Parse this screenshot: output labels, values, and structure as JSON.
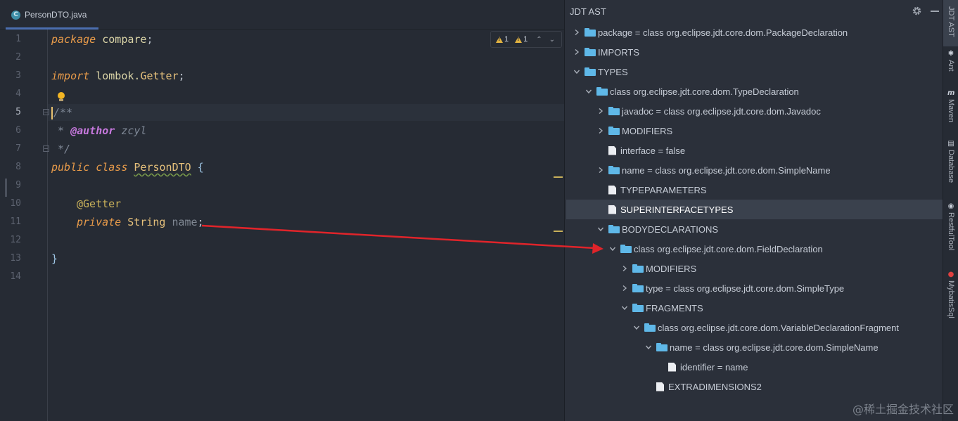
{
  "editor": {
    "tab_label": "PersonDTO.java",
    "tab_icon_letter": "C",
    "line_numbers": [
      "1",
      "2",
      "3",
      "4",
      "5",
      "6",
      "7",
      "8",
      "9",
      "10",
      "11",
      "12",
      "13",
      "14"
    ],
    "code": {
      "l1_kw": "package",
      "l1_name": " compare",
      "l1_semi": ";",
      "l3_kw": "import",
      "l3_pkg": " lombok.",
      "l3_cls": "Getter",
      "l3_semi": ";",
      "l5_open": "/**",
      "l6_star": " * ",
      "l6_tag": "@author",
      "l6_text": " zcyl",
      "l7_close": " */",
      "l8_kw": "public class",
      "l8_space": " ",
      "l8_cls": "PersonDTO",
      "l8_brace": " {",
      "l10_ann": "@Getter",
      "l11_kw": "private",
      "l11_type": " String",
      "l11_field": " name",
      "l11_semi": ";",
      "l13_brace": "}"
    },
    "inspection": {
      "warn1": "1",
      "warn2": "1"
    }
  },
  "panel": {
    "title": "JDT AST",
    "rows": [
      "package = class org.eclipse.jdt.core.dom.PackageDeclaration",
      "IMPORTS",
      "TYPES",
      "class org.eclipse.jdt.core.dom.TypeDeclaration",
      "javadoc = class org.eclipse.jdt.core.dom.Javadoc",
      "MODIFIERS",
      "interface = false",
      "name = class org.eclipse.jdt.core.dom.SimpleName",
      "TYPEPARAMETERS",
      "SUPERINTERFACETYPES",
      "BODYDECLARATIONS",
      "class org.eclipse.jdt.core.dom.FieldDeclaration",
      "MODIFIERS",
      "type = class org.eclipse.jdt.core.dom.SimpleType",
      "FRAGMENTS",
      "class org.eclipse.jdt.core.dom.VariableDeclarationFragment",
      "name = class org.eclipse.jdt.core.dom.SimpleName",
      "identifier = name",
      "EXTRADIMENSIONS2"
    ]
  },
  "tool_strip": {
    "items": [
      "JDT AST",
      "Ant",
      "Maven",
      "Database",
      "RestfulTool",
      "MybatisSql"
    ]
  },
  "watermark": "@稀土掘金技术社区",
  "colors": {
    "accent": "#4b6eaf",
    "folder": "#5fb8e8",
    "arrow": "#e0242a",
    "warning": "#e2b341"
  }
}
